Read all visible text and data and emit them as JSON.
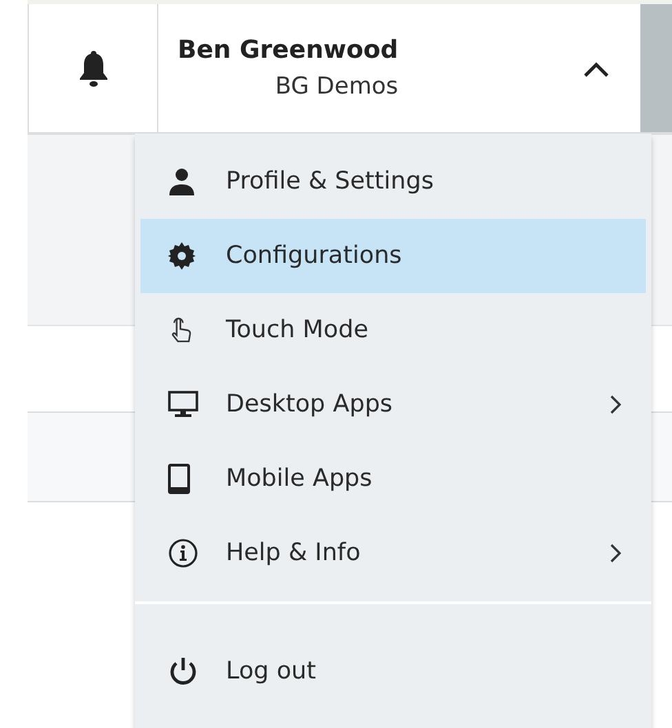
{
  "user": {
    "name": "Ben Greenwood",
    "org": "BG Demos",
    "menu_open": true
  },
  "menu": {
    "items": [
      {
        "label": "Profile & Settings",
        "selected": false,
        "submenu": false,
        "separated": false
      },
      {
        "label": "Configurations",
        "selected": true,
        "submenu": false,
        "separated": false
      },
      {
        "label": "Touch Mode",
        "selected": false,
        "submenu": false,
        "separated": false
      },
      {
        "label": "Desktop Apps",
        "selected": false,
        "submenu": true,
        "separated": false
      },
      {
        "label": "Mobile Apps",
        "selected": false,
        "submenu": false,
        "separated": false
      },
      {
        "label": "Help & Info",
        "selected": false,
        "submenu": true,
        "separated": false
      },
      {
        "label": "Log out",
        "selected": false,
        "submenu": false,
        "separated": true
      }
    ]
  }
}
